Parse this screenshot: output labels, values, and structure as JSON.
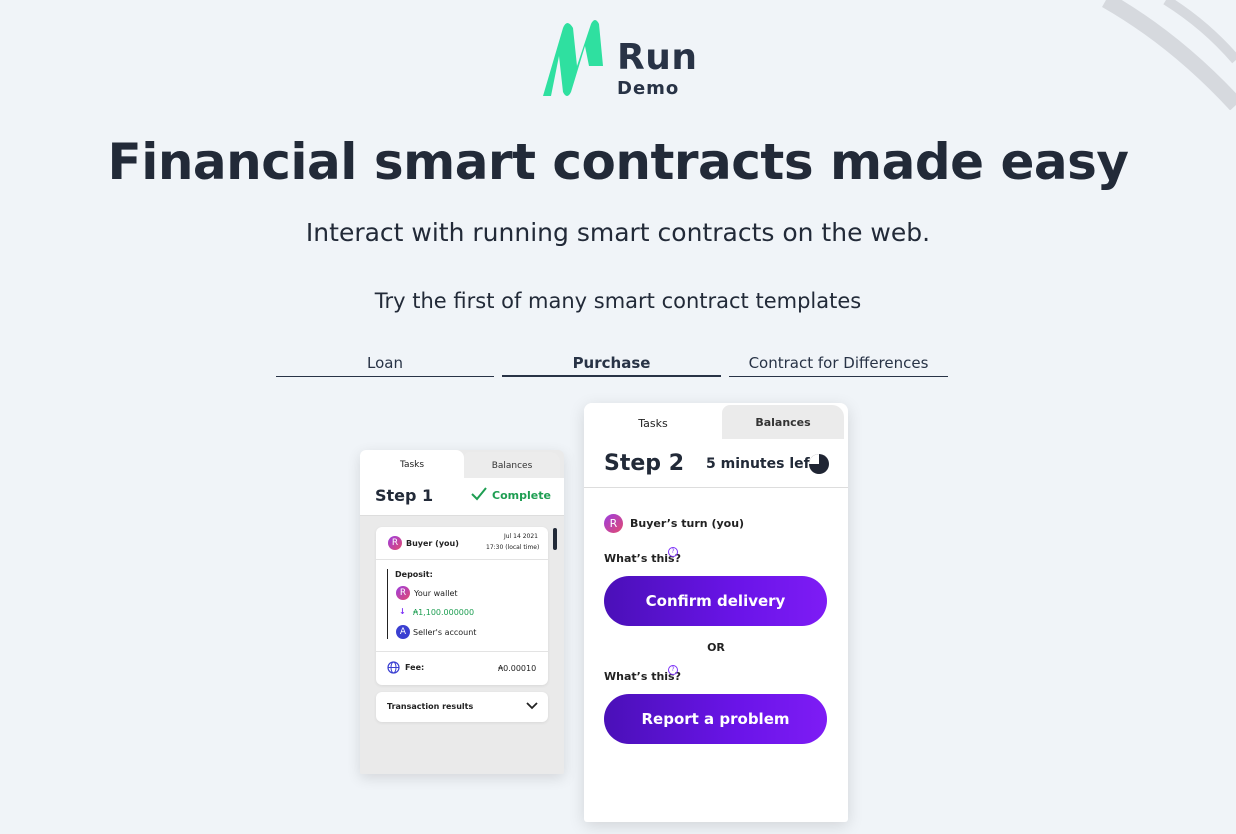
{
  "brand": {
    "name": "Run",
    "subtitle": "Demo",
    "accent": "#2fe0a0"
  },
  "hero": {
    "title": "Financial smart contracts made easy",
    "tagline": "Interact with running smart contracts on the web.",
    "templates_prompt": "Try the first of many smart contract templates"
  },
  "template_tabs": [
    {
      "label": "Loan",
      "active": false
    },
    {
      "label": "Purchase",
      "active": true
    },
    {
      "label": "Contract for Differences",
      "active": false
    }
  ],
  "step1_card": {
    "tabs": [
      "Tasks",
      "Balances"
    ],
    "step": "Step 1",
    "status": "Complete",
    "status_color": "#1e9e52",
    "actor": {
      "avatar": "R",
      "label": "Buyer (you)"
    },
    "date": "Jul 14 2021",
    "time": "17:30 (local time)",
    "deposit_label": "Deposit:",
    "from": {
      "avatar": "R",
      "label": "Your wallet"
    },
    "amount": "₳1,100.000000",
    "to": {
      "avatar": "A",
      "label": "Seller's account"
    },
    "fee_label": "Fee:",
    "fee_value": "₳0.00010",
    "results_label": "Transaction results"
  },
  "step2_card": {
    "tabs": [
      "Tasks",
      "Balances"
    ],
    "step": "Step 2",
    "timer": "5 minutes left",
    "turn": {
      "avatar": "R",
      "label": "Buyer’s turn (you)"
    },
    "whats_this": "What’s this?",
    "confirm_button": "Confirm delivery",
    "or": "OR",
    "report_button": "Report a problem",
    "button_color": "#5b12d6"
  }
}
